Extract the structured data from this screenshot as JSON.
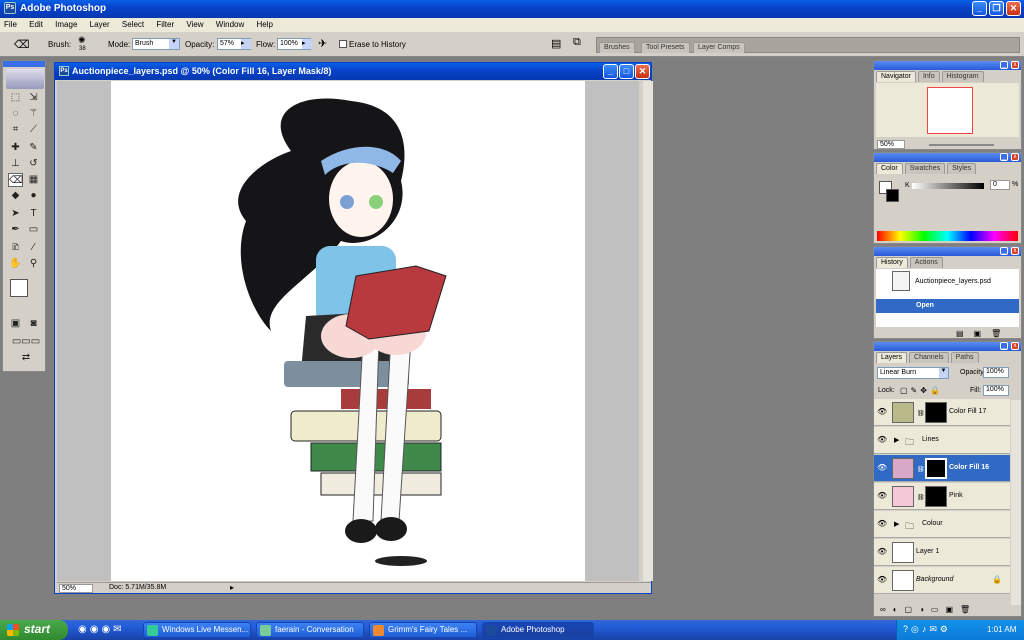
{
  "app": {
    "title": "Adobe Photoshop"
  },
  "menu": [
    "File",
    "Edit",
    "Image",
    "Layer",
    "Select",
    "Filter",
    "View",
    "Window",
    "Help"
  ],
  "options": {
    "brush_label": "Brush:",
    "brush_size": "38",
    "mode_label": "Mode:",
    "mode_value": "Brush",
    "opacity_label": "Opacity:",
    "opacity_value": "57%",
    "flow_label": "Flow:",
    "flow_value": "100%",
    "erase_history": "Erase to History",
    "well_tabs": [
      "Brushes",
      "Tool Presets",
      "Layer Comps"
    ]
  },
  "document": {
    "title": "Auctionpiece_layers.psd @ 50% (Color Fill 16, Layer Mask/8)",
    "zoom": "50%",
    "doc_size": "Doc: 5.71M/35.8M"
  },
  "navigator": {
    "tabs": [
      "Navigator",
      "Info",
      "Histogram"
    ],
    "zoom": "50%"
  },
  "color_panel": {
    "tabs": [
      "Color",
      "Swatches",
      "Styles"
    ],
    "k_label": "K",
    "k_value": "0",
    "unit": "%"
  },
  "history": {
    "tabs": [
      "History",
      "Actions"
    ],
    "snapshot": "Auctionpiece_layers.psd",
    "state": "Open"
  },
  "layers_panel": {
    "tabs": [
      "Layers",
      "Channels",
      "Paths"
    ],
    "blend_mode": "Linear Burn",
    "opacity_label": "Opacity:",
    "opacity_value": "100%",
    "lock_label": "Lock:",
    "fill_label": "Fill:",
    "fill_value": "100%",
    "layers": [
      {
        "name": "Color Fill 17",
        "thumb": "#b9b98a"
      },
      {
        "name": "Lines",
        "thumb": ""
      },
      {
        "name": "Color Fill 16",
        "thumb": "#d7a8c8"
      },
      {
        "name": "Pink",
        "thumb": "#f5c8d8"
      },
      {
        "name": "Colour",
        "thumb": ""
      },
      {
        "name": "Layer 1",
        "thumb": "#ffffff"
      },
      {
        "name": "Background",
        "thumb": "#ffffff"
      }
    ]
  },
  "taskbar": {
    "start": "start",
    "items": [
      "Windows Live Messen...",
      "faerain - Conversation",
      "Grimm's Fairy Tales ...",
      "Adobe Photoshop"
    ],
    "clock": "1:01 AM"
  },
  "colors": {
    "xp_blue": "#0842c8",
    "selection": "#316ac5",
    "start_green": "#3c9b3c"
  }
}
